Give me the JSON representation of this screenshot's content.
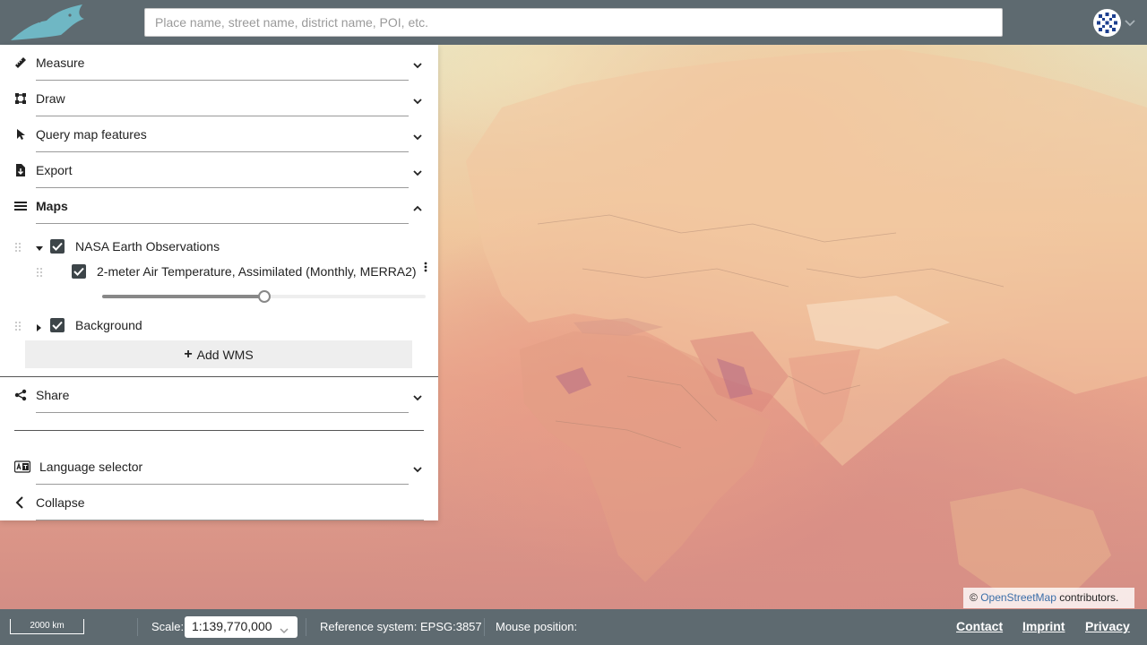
{
  "header": {
    "logo_icon": "fish-logo-icon",
    "search_placeholder": "Place name, street name, district name, POI, etc.",
    "search_value": "",
    "user_icon": "user-avatar-icon",
    "user_menu_icon": "chevron-down-icon",
    "background_color": "#5e6a70"
  },
  "sidebar": {
    "tools": [
      {
        "label": "Measure",
        "icon": "ruler-icon",
        "expanded": false
      },
      {
        "label": "Draw",
        "icon": "draw-polygon-icon",
        "expanded": false
      },
      {
        "label": "Query map features",
        "icon": "pointer-icon",
        "expanded": false
      },
      {
        "label": "Export",
        "icon": "file-export-icon",
        "expanded": false
      },
      {
        "label": "Maps",
        "icon": "list-icon",
        "expanded": true
      }
    ],
    "layers": [
      {
        "label": "NASA Earth Observations",
        "checked": true,
        "expanded": true,
        "children": [
          {
            "label": "2-meter Air Temperature, Assimilated (Monthly, MERRA2)",
            "checked": true,
            "opacity": 0.5
          }
        ]
      },
      {
        "label": "Background",
        "checked": true,
        "expanded": false
      }
    ],
    "add_wms_label": "Add WMS",
    "share_label": "Share",
    "share_icon": "share-icon",
    "language_label": "Language selector",
    "language_icon": "language-icon",
    "collapse_label": "Collapse",
    "collapse_icon": "chevron-left-icon"
  },
  "map": {
    "attribution_prefix": "©",
    "attribution_link": "OpenStreetMap",
    "attribution_suffix": "contributors."
  },
  "footer": {
    "scalebar_label": "2000 km",
    "scale_label": "Scale:",
    "scale_value": "1:139,770,000",
    "reference_system": "Reference system: EPSG:3857",
    "mouse_position_label": "Mouse position:",
    "links": [
      "Contact",
      "Imprint",
      "Privacy"
    ]
  }
}
